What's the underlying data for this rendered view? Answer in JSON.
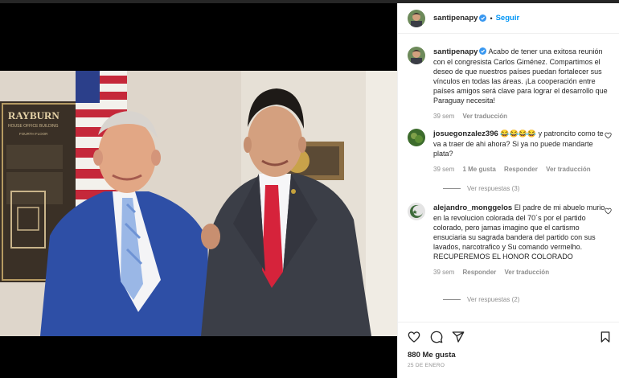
{
  "post": {
    "username": "santipenapy",
    "follow_label": "Seguir",
    "dot": "•",
    "caption": "Acabo de tener una exitosa reunión con el congresista Carlos Giménez. Compartimos el deseo de que nuestros países puedan fortalecer sus vínculos en todas las áreas. ¡La cooperación entre países amigos será clave para lograr el desarrollo que Paraguay necesita!",
    "caption_time": "39 sem",
    "see_translation": "Ver traducción",
    "likes": "880 Me gusta",
    "date": "25 DE ENERO"
  },
  "photo": {
    "sign_title": "RAYBURN",
    "sign_sub": "HOUSE OFFICE BUILDING",
    "sign_floor": "FOURTH FLOOR"
  },
  "comments": [
    {
      "username": "josuegonzalez396",
      "text": "😂😂😂😂 y patroncito como te va a traer de ahi ahora? Si ya no puede mandarte plata?",
      "time": "39 sem",
      "likes": "1 Me gusta",
      "reply": "Responder",
      "translate": "Ver traducción",
      "view_replies": "Ver respuestas (3)"
    },
    {
      "username": "alejandro_monggelos",
      "text": "El padre de mi abuelo murio en la revolucion colorada del 70´s por el partido colorado, pero jamas imagino que el cartismo ensuciaria su sagrada bandera del partido con sus lavados, narcotrafico y Su comando vermelho. RECUPEREMOS EL HONOR COLORADO",
      "time": "39 sem",
      "reply": "Responder",
      "translate": "Ver traducción",
      "view_replies": "Ver respuestas (2)"
    }
  ],
  "icons": [
    "verified-badge-icon",
    "heart-icon",
    "comment-icon",
    "share-icon",
    "bookmark-icon"
  ],
  "colors": {
    "link": "#0095f6",
    "verified": "#3897f0",
    "muted": "#8e8e8e"
  }
}
